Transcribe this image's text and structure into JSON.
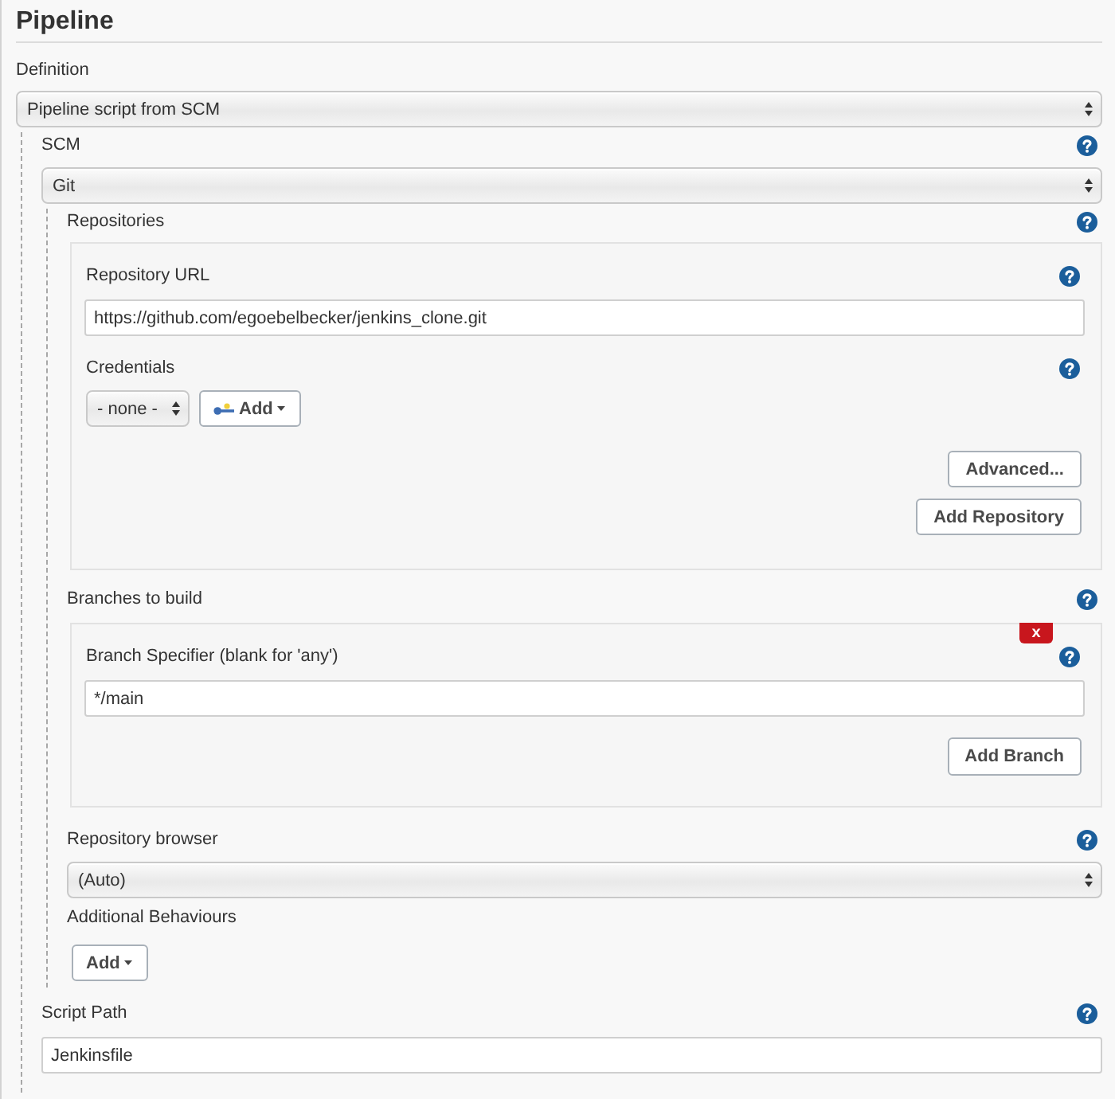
{
  "section": {
    "title": "Pipeline"
  },
  "definition": {
    "label": "Definition",
    "value": "Pipeline script from SCM"
  },
  "scm": {
    "label": "SCM",
    "value": "Git",
    "repositories": {
      "label": "Repositories",
      "items": [
        {
          "url_label": "Repository URL",
          "url": "https://github.com/egoebelbecker/jenkins_clone.git",
          "credentials_label": "Credentials",
          "credentials": "- none -",
          "add_credentials_button": "Add",
          "advanced_button": "Advanced..."
        }
      ],
      "add_button": "Add Repository"
    },
    "branches": {
      "label": "Branches to build",
      "items": [
        {
          "delete_button": "x",
          "label": "Branch Specifier (blank for 'any')",
          "value": "*/main"
        }
      ],
      "add_button": "Add Branch"
    },
    "repository_browser": {
      "label": "Repository browser",
      "value": "(Auto)"
    },
    "additional_behaviours": {
      "label": "Additional Behaviours",
      "add_button": "Add"
    }
  },
  "script_path": {
    "label": "Script Path",
    "value": "Jenkinsfile"
  }
}
